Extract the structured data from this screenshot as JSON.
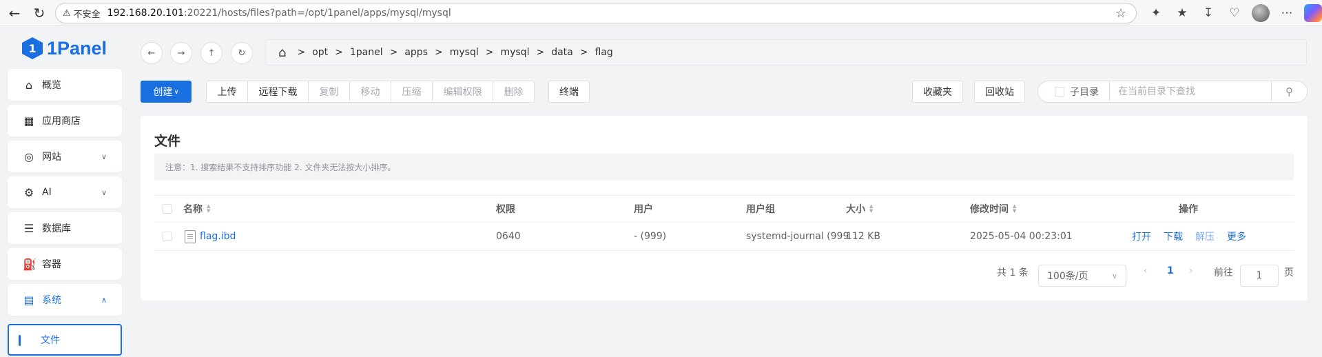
{
  "browser": {
    "security_label": "不安全",
    "url_host": "192.168.20.101",
    "url_rest": ":20221/hosts/files?path=/opt/1panel/apps/mysql/mysql"
  },
  "app": {
    "logo_text": "1Panel",
    "logo_mark": "1"
  },
  "sidebar": {
    "items": [
      {
        "label": "概览",
        "icon": "home-icon"
      },
      {
        "label": "应用商店",
        "icon": "grid-icon"
      },
      {
        "label": "网站",
        "icon": "globe-icon"
      },
      {
        "label": "AI",
        "icon": "robot-icon"
      },
      {
        "label": "数据库",
        "icon": "layers-icon"
      },
      {
        "label": "容器",
        "icon": "docker-icon"
      },
      {
        "label": "系统",
        "icon": "server-icon"
      }
    ],
    "submenu": {
      "label": "文件"
    }
  },
  "breadcrumb": [
    "opt",
    "1panel",
    "apps",
    "mysql",
    "mysql",
    "data",
    "flag"
  ],
  "toolbar": {
    "create": "创建",
    "upload": "上传",
    "remote_download": "远程下载",
    "copy": "复制",
    "move": "移动",
    "compress": "压缩",
    "edit_perm": "编辑权限",
    "delete": "删除",
    "terminal": "终端",
    "favorites": "收藏夹",
    "recycle": "回收站",
    "subdir": "子目录",
    "search_placeholder": "在当前目录下查找"
  },
  "card": {
    "title": "文件",
    "notice": "注意：1. 搜索结果不支持排序功能 2. 文件夹无法按大小排序。"
  },
  "table": {
    "headers": {
      "name": "名称",
      "perm": "权限",
      "user": "用户",
      "group": "用户组",
      "size": "大小",
      "modified": "修改时间",
      "ops": "操作"
    },
    "rows": [
      {
        "name": "flag.ibd",
        "perm": "0640",
        "user": "- (999)",
        "group": "systemd-journal (999",
        "size": "112 KB",
        "modified": "2025-05-04 00:23:01",
        "ops": [
          "打开",
          "下载",
          "解压",
          "更多"
        ]
      }
    ]
  },
  "pagination": {
    "total": "共 1 条",
    "page_size": "100条/页",
    "current": "1",
    "goto_label": "前往",
    "goto_value": "1",
    "page_suffix": "页"
  },
  "colors": {
    "accent": "#1a6fe0"
  }
}
